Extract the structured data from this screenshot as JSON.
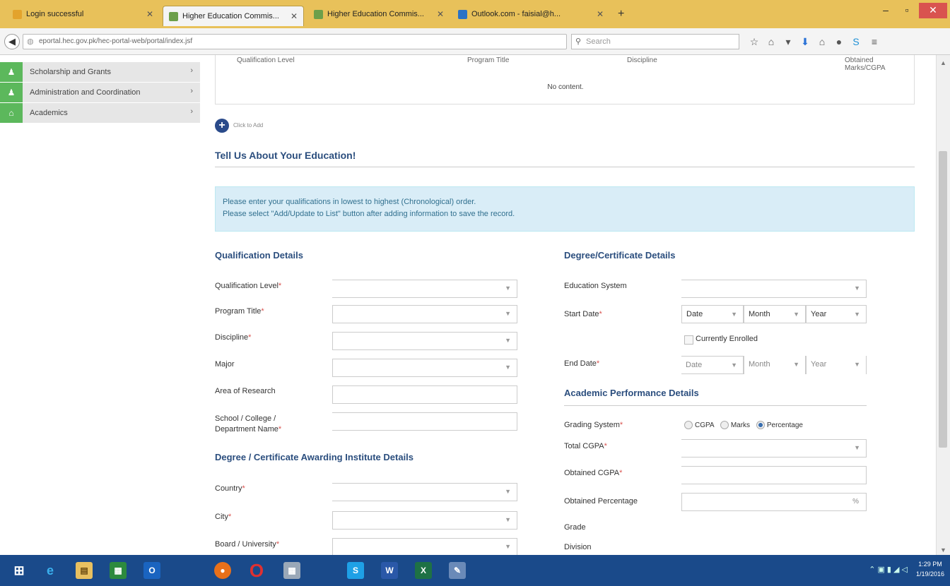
{
  "browser": {
    "tabs": [
      {
        "label": "Login successful",
        "color": "#e3a32c"
      },
      {
        "label": "Higher Education Commis...",
        "color": "#6c9f4a"
      },
      {
        "label": "Higher Education Commis...",
        "color": "#6c9f4a"
      },
      {
        "label": "Outlook.com - faisial@h...",
        "color": "#2a72c6"
      }
    ],
    "url": "eportal.hec.gov.pk/hec-portal-web/portal/index.jsf",
    "search_placeholder": "Search"
  },
  "sidebar": {
    "items": [
      {
        "label": "Scholarship and Grants",
        "icon": "person-icon"
      },
      {
        "label": "Administration and Coordination",
        "icon": "person-icon"
      },
      {
        "label": "Academics",
        "icon": "graduation-cap-icon"
      }
    ]
  },
  "table": {
    "headers": [
      "Qualification Level",
      "Program Title",
      "Discipline",
      "Obtained Marks/CGPA"
    ],
    "empty_text": "No content."
  },
  "add_label": "Click to Add",
  "main": {
    "heading": "Tell Us About Your Education!",
    "info_lines": [
      "Please enter your qualifications in lowest to highest (Chronological) order.",
      "Please select \"Add/Update to List\" button after adding information to save the record."
    ]
  },
  "qualification": {
    "title": "Qualification Details",
    "qualification_level": "Qualification Level",
    "program_title": "Program Title",
    "discipline": "Discipline",
    "major": "Major",
    "area_of_research": "Area of Research",
    "school_line1": "School / College /",
    "school_line2": "Department Name"
  },
  "institute": {
    "title": "Degree / Certificate Awarding Institute Details",
    "country": "Country",
    "city": "City",
    "board": "Board / University"
  },
  "degree": {
    "title": "Degree/Certificate Details",
    "education_system": "Education System",
    "start_date": "Start Date",
    "end_date": "End Date",
    "currently_enrolled": "Currently Enrolled",
    "date_parts": [
      "Date",
      "Month",
      "Year"
    ]
  },
  "academic": {
    "title": "Academic Performance Details",
    "grading_system": "Grading System",
    "grading_options": [
      "CGPA",
      "Marks",
      "Percentage"
    ],
    "grading_selected": "Percentage",
    "total_cgpa": "Total CGPA",
    "obtained_cgpa": "Obtained CGPA",
    "obtained_percentage": "Obtained Percentage",
    "percent_suffix": "%",
    "grade": "Grade",
    "division": "Division"
  },
  "taskbar": {
    "time": "1:29 PM",
    "date": "1/19/2016"
  }
}
